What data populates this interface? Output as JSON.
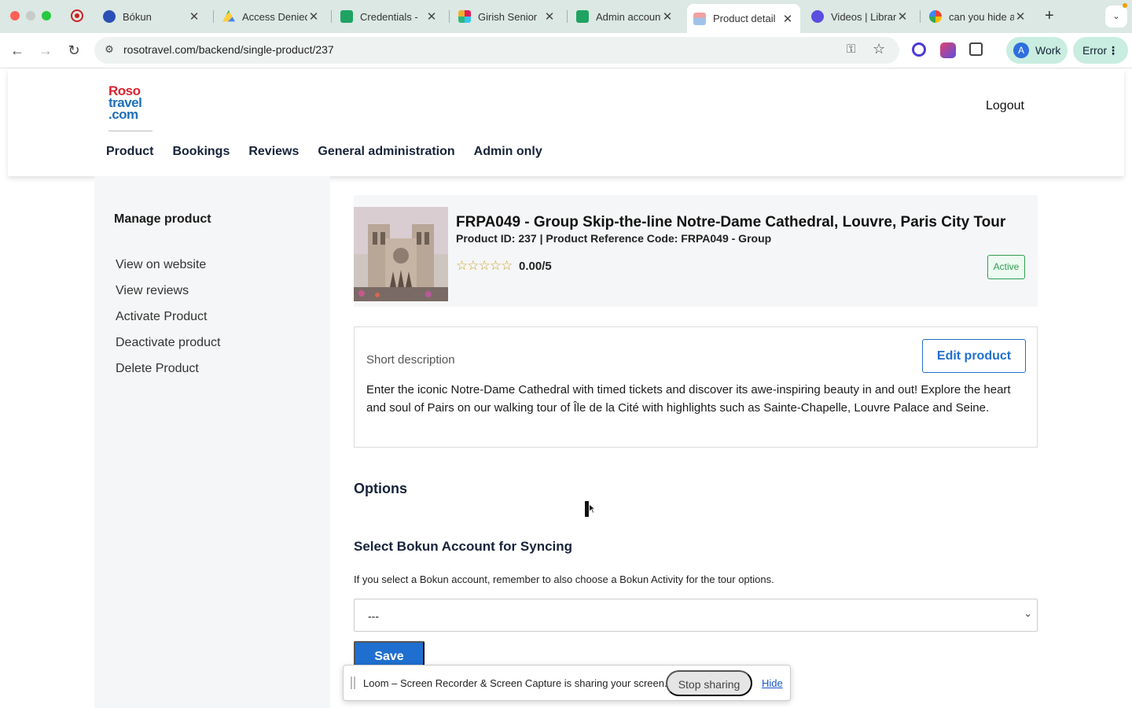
{
  "browser": {
    "tabs": [
      {
        "title": "Bókun",
        "active": false
      },
      {
        "title": "Access Denied",
        "active": false
      },
      {
        "title": "Credentials -",
        "active": false
      },
      {
        "title": "Girish Senior",
        "active": false
      },
      {
        "title": "Admin account",
        "active": false
      },
      {
        "title": "Product detail",
        "active": true
      },
      {
        "title": "Videos | Library",
        "active": false
      },
      {
        "title": "can you hide a",
        "active": false
      }
    ],
    "url": "rosotravel.com/backend/single-product/237",
    "profile_initial": "A",
    "profile_label": "Work",
    "error_label": "Error"
  },
  "site": {
    "logo": {
      "line1": "Roso",
      "line2": "travel",
      "line3": ".com"
    },
    "logout_label": "Logout",
    "nav": [
      "Product",
      "Bookings",
      "Reviews",
      "General administration",
      "Admin only"
    ]
  },
  "sidebar": {
    "title": "Manage product",
    "items": [
      "View on website",
      "View reviews",
      "Activate Product",
      "Deactivate product",
      "Delete Product"
    ]
  },
  "product": {
    "title": "FRPA049 - Group  Skip-the-line Notre-Dame Cathedral, Louvre, Paris City Tour",
    "meta": "Product ID: 237 | Product Reference Code: FRPA049 - Group",
    "stars": "☆☆☆☆☆",
    "rating": "0.00/5",
    "status": "Active"
  },
  "description": {
    "label": "Short description",
    "edit_label": "Edit product",
    "text": "Enter the iconic Notre-Dame Cathedral with timed tickets and discover its awe-inspiring beauty in and out! Explore the heart and soul of Pairs on our walking tour of Île de la Cité with highlights such as Sainte-Chapelle, Louvre Palace and Seine."
  },
  "options": {
    "heading": "Options",
    "sync_heading": "Select Bokun Account for Syncing",
    "sync_help": "If you select a Bokun account, remember to also choose a Bokun Activity for the tour options.",
    "selected_account": "---",
    "save_label": "Save"
  },
  "loom": {
    "message": "Loom – Screen Recorder & Screen Capture is sharing your screen.",
    "stop_label": "Stop sharing",
    "hide_label": "Hide"
  },
  "colors": {
    "brand_red": "#d9232d",
    "brand_blue": "#1e6fb8",
    "primary_button": "#1f6fd0",
    "active_green": "#2f9e52"
  }
}
